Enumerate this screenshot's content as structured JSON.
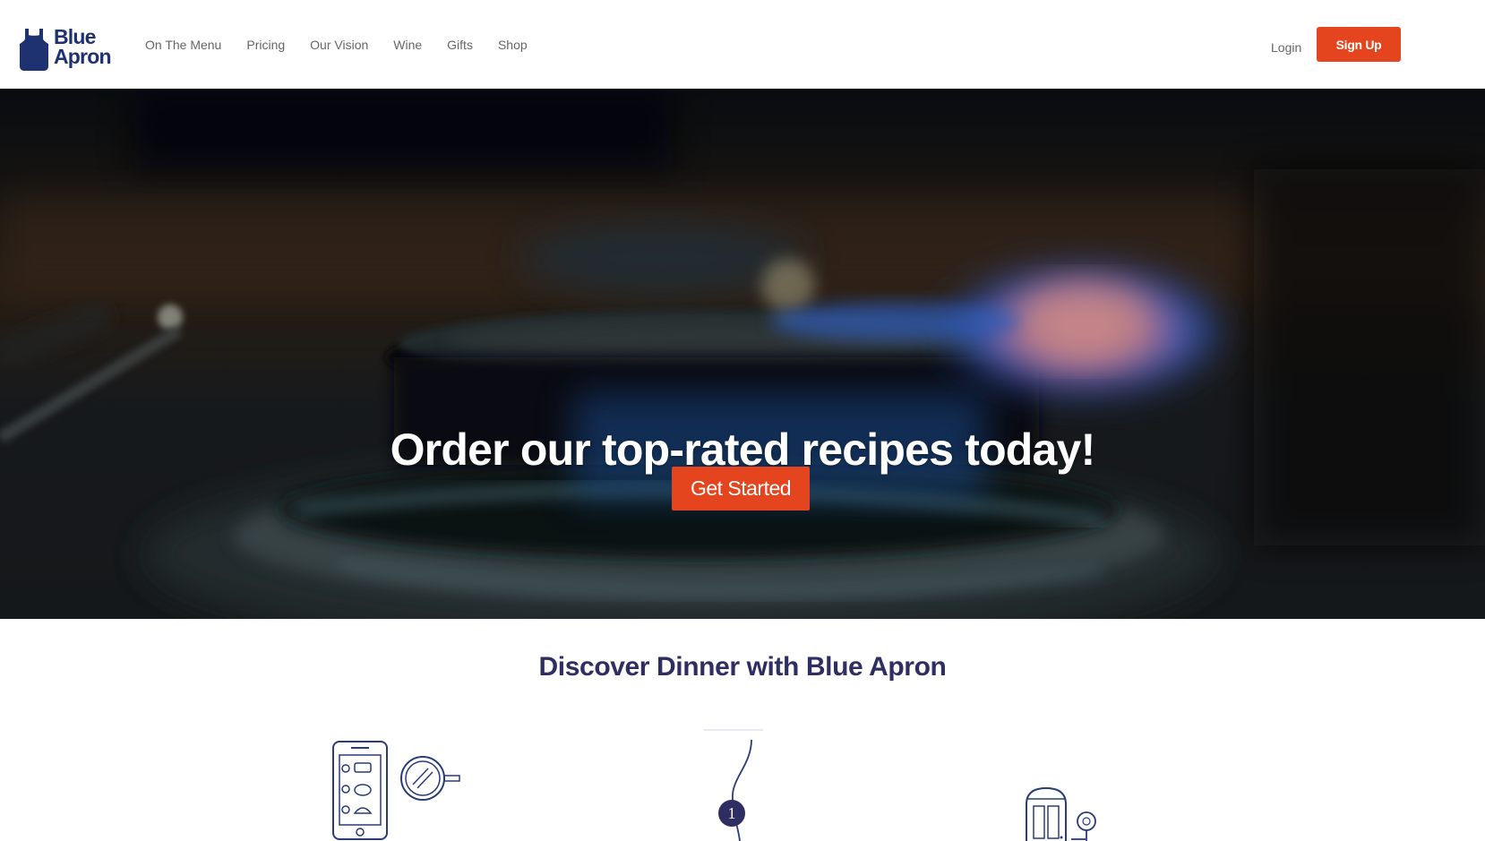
{
  "brand": {
    "line1": "Blue",
    "line2": "Apron",
    "color": "#1e3170"
  },
  "nav": {
    "items": [
      {
        "label": "On The Menu"
      },
      {
        "label": "Pricing"
      },
      {
        "label": "Our Vision"
      },
      {
        "label": "Wine"
      },
      {
        "label": "Gifts"
      },
      {
        "label": "Shop"
      }
    ],
    "login": "Login",
    "signup": "Sign Up"
  },
  "hero": {
    "title": "Order our top-rated recipes today!",
    "cta": "Get Started"
  },
  "discover": {
    "title": "Discover Dinner with Blue Apron",
    "step_number": "1"
  },
  "colors": {
    "accent": "#e4451e",
    "heading": "#2f2e62",
    "nav_text": "#666666",
    "illustration": "#2a3b7a"
  },
  "icons": [
    "apron-logo-icon",
    "phone-menu-icon",
    "frying-pan-icon",
    "step-connector-icon",
    "fridge-icon",
    "flower-icon"
  ]
}
